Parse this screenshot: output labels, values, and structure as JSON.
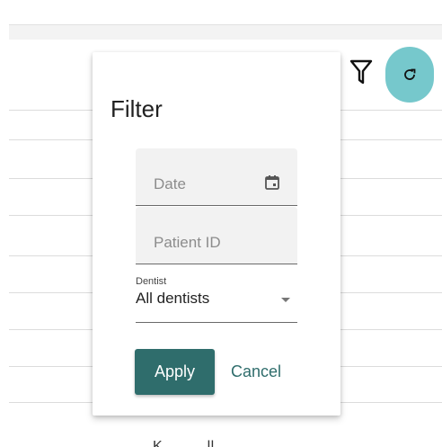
{
  "toolbar": {
    "filter_icon": "funnel-icon",
    "refresh_icon": "refresh-icon",
    "refresh_color": "#76c8cc"
  },
  "background": {
    "partial_text": "K     ..   ..  ..   ll  ..   ."
  },
  "filter_dialog": {
    "title": "Filter",
    "date_field": {
      "placeholder": "Date",
      "icon": "calendar-icon"
    },
    "patient_id_field": {
      "placeholder": "Patient ID"
    },
    "dentist_field": {
      "label": "Dentist",
      "value": "All dentists",
      "icon": "chevron-down-icon"
    },
    "apply_label": "Apply",
    "cancel_label": "Cancel",
    "accent_color": "#2f6d6c"
  }
}
